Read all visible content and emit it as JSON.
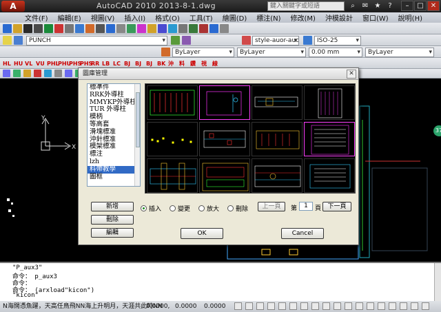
{
  "app": {
    "app_button": "A",
    "title": "AutoCAD 2010     2013-8-1.dwg",
    "search_placeholder": "鍵入關鍵字或短語"
  },
  "menu": [
    "文件(F)",
    "編輯(E)",
    "視圖(V)",
    "插入(I)",
    "格式(O)",
    "工具(T)",
    "繪圖(D)",
    "標注(N)",
    "修改(M)",
    "沖模設計",
    "窗口(W)",
    "說明(H)"
  ],
  "toolbar2": {
    "layer_dd": "PUNCH",
    "style_dd": "style-auor-auo",
    "dim_dd": "ISO-25"
  },
  "toolbar3": {
    "color_dd": "ByLayer",
    "linetype_dd": "ByLayer",
    "lineweight_dd": "0.00 mm",
    "plotstyle_dd": "ByLayer"
  },
  "red_tools": [
    "HL",
    "HU",
    "VL",
    "VU",
    "PHL",
    "PHU",
    "PHS",
    "PHS",
    "RR",
    "LB",
    "LC",
    "BJ",
    "BJ",
    "BJ",
    "BK",
    "沖",
    "料",
    "鑽",
    "視",
    "線"
  ],
  "nav_badge": "37",
  "dialog": {
    "title": "圖庫管理",
    "close": "✕",
    "list": [
      "標準件",
      "RRK外導柱",
      "MMYKP外導柱",
      "TUR 外導柱",
      "模柄",
      "等高套",
      "滑塊標准",
      "沖針標准",
      "模架標准",
      "標注",
      "lzh",
      "料帶教學",
      "圖框"
    ],
    "selected_index": 11,
    "buttons": {
      "add": "新增",
      "delete": "刪除",
      "edit": "編輯",
      "ok": "OK",
      "cancel": "Cancel",
      "prev": "上一頁",
      "next": "下一頁"
    },
    "radios": [
      "插入",
      "變更",
      "放大",
      "刪除"
    ],
    "radio_selected": 0,
    "page_label_pre": "第",
    "page_value": "1",
    "page_label_post": "頁"
  },
  "command_lines": [
    "\"P_aux3\"",
    "命令： p_aux3",
    "命令：",
    "命令： (arxload\"kicon\")",
    "\"kicon\""
  ],
  "status": {
    "text": "N海闊憑魚躍，天高任鳥飛NN海上升明月，天涯共此時NN",
    "coord_x": "0.0000,",
    "coord_y": "0.0000",
    "coord_z": "0.0000"
  }
}
